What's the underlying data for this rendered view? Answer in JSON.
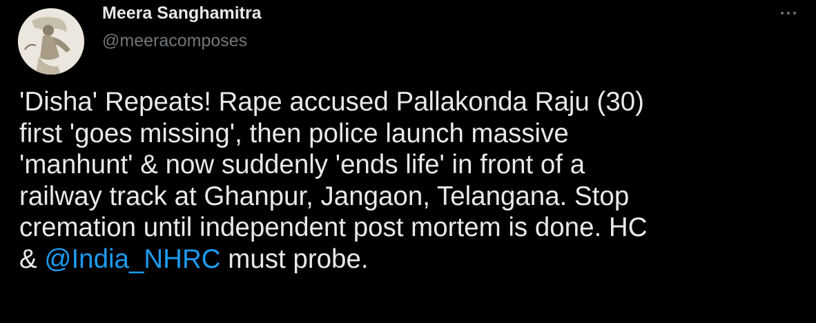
{
  "user": {
    "display_name": "Meera Sanghamitra",
    "handle": "@meeracomposes",
    "avatar_icon": "profile-photo"
  },
  "menu": {
    "icon": "more-horizontal-icon"
  },
  "tweet": {
    "lines": [
      "'Disha' Repeats! Rape accused Pallakonda Raju (30)",
      "first 'goes missing', then police launch massive",
      "'manhunt' & now suddenly 'ends life' in front of a",
      "railway track at Ghanpur, Jangaon, Telangana. Stop",
      "cremation until independent post mortem is done. HC"
    ],
    "last_line_prefix": "& ",
    "mention": "@India_NHRC",
    "last_line_suffix": " must probe."
  },
  "colors": {
    "background": "#000000",
    "text": "#e7e9ea",
    "secondary": "#71767b",
    "link": "#1d9bf0"
  }
}
